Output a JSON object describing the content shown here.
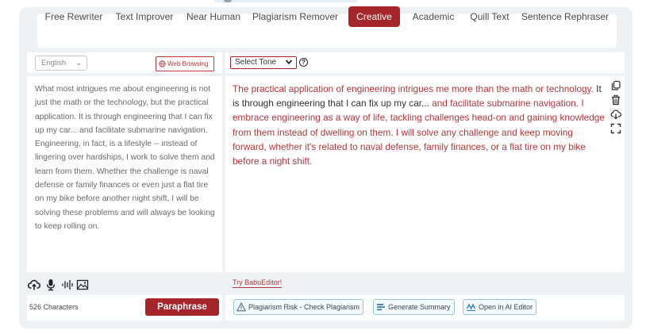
{
  "modes": [
    {
      "label": "Free Rewriter",
      "active": false
    },
    {
      "label": "Text Improver",
      "active": false
    },
    {
      "label": "Near Human",
      "active": false
    },
    {
      "label": "Plagiarism Remover",
      "active": false
    },
    {
      "label": "Creative",
      "active": true
    },
    {
      "label": "Academic",
      "active": false
    },
    {
      "label": "Quill Text",
      "active": false
    },
    {
      "label": "Sentence Rephraser",
      "active": false
    }
  ],
  "input": {
    "language": "English",
    "web_browsing_label": "Web Browsing",
    "text": "What most intrigues me about engineering is not just the math or the technology, but the practical application. It is through engineering that I can fix up my car... and facilitate submarine navigation. Engineering, in fact, is a lifestyle --  instead of lingering over hardships, I work to solve them and learn from them. Whether the challenge is naval defense or family finances or even just a flat tire on my bike before another night shift, I will be solving these problems and will always be looking to keep rolling on.",
    "char_count": "526 Characters",
    "paraphrase_label": "Paraphrase"
  },
  "output": {
    "tone_placeholder": "Select Tone",
    "help_symbol": "?",
    "segments": [
      {
        "text": "The practical application of engineering intrigues me more than the math or technology.",
        "highlight": true
      },
      {
        "text": " It is through engineering that I can fix up my car...",
        "highlight": false
      },
      {
        "text": " and facilitate submarine navigation. I embrace engineering as a way of life, tackling challenges head-on and gaining knowledge from them instead of dwelling on them. I will solve any challenge and keep moving forward, whether it's related to naval defense, family finances, or a flat tire on my bike before a night shift.",
        "highlight": true
      }
    ],
    "try_editor_label": "Try BabuEditor!",
    "tools": [
      {
        "label": "Plagiarism Risk - Check Plagiarism",
        "icon": "warning-triangle-icon"
      },
      {
        "label": "Generate Summary",
        "icon": "summary-lines-icon"
      },
      {
        "label": "Open in AI Editor",
        "icon": "ai-editor-icon"
      }
    ]
  },
  "colors": {
    "accent": "#a5262a",
    "highlight_text": "#b6373c",
    "frame_bg": "#eef2f5",
    "tool_border": "#9bc3dc"
  }
}
